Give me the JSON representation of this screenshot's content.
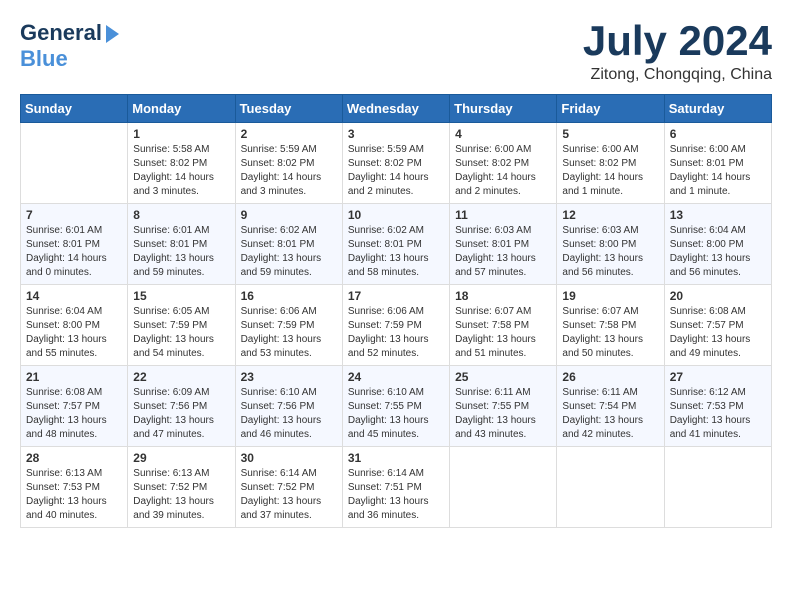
{
  "header": {
    "logo_general": "General",
    "logo_blue": "Blue",
    "month_title": "July 2024",
    "location": "Zitong, Chongqing, China"
  },
  "calendar": {
    "days_of_week": [
      "Sunday",
      "Monday",
      "Tuesday",
      "Wednesday",
      "Thursday",
      "Friday",
      "Saturday"
    ],
    "weeks": [
      [
        {
          "day": "",
          "info": ""
        },
        {
          "day": "1",
          "info": "Sunrise: 5:58 AM\nSunset: 8:02 PM\nDaylight: 14 hours\nand 3 minutes."
        },
        {
          "day": "2",
          "info": "Sunrise: 5:59 AM\nSunset: 8:02 PM\nDaylight: 14 hours\nand 3 minutes."
        },
        {
          "day": "3",
          "info": "Sunrise: 5:59 AM\nSunset: 8:02 PM\nDaylight: 14 hours\nand 2 minutes."
        },
        {
          "day": "4",
          "info": "Sunrise: 6:00 AM\nSunset: 8:02 PM\nDaylight: 14 hours\nand 2 minutes."
        },
        {
          "day": "5",
          "info": "Sunrise: 6:00 AM\nSunset: 8:02 PM\nDaylight: 14 hours\nand 1 minute."
        },
        {
          "day": "6",
          "info": "Sunrise: 6:00 AM\nSunset: 8:01 PM\nDaylight: 14 hours\nand 1 minute."
        }
      ],
      [
        {
          "day": "7",
          "info": "Sunrise: 6:01 AM\nSunset: 8:01 PM\nDaylight: 14 hours\nand 0 minutes."
        },
        {
          "day": "8",
          "info": "Sunrise: 6:01 AM\nSunset: 8:01 PM\nDaylight: 13 hours\nand 59 minutes."
        },
        {
          "day": "9",
          "info": "Sunrise: 6:02 AM\nSunset: 8:01 PM\nDaylight: 13 hours\nand 59 minutes."
        },
        {
          "day": "10",
          "info": "Sunrise: 6:02 AM\nSunset: 8:01 PM\nDaylight: 13 hours\nand 58 minutes."
        },
        {
          "day": "11",
          "info": "Sunrise: 6:03 AM\nSunset: 8:01 PM\nDaylight: 13 hours\nand 57 minutes."
        },
        {
          "day": "12",
          "info": "Sunrise: 6:03 AM\nSunset: 8:00 PM\nDaylight: 13 hours\nand 56 minutes."
        },
        {
          "day": "13",
          "info": "Sunrise: 6:04 AM\nSunset: 8:00 PM\nDaylight: 13 hours\nand 56 minutes."
        }
      ],
      [
        {
          "day": "14",
          "info": "Sunrise: 6:04 AM\nSunset: 8:00 PM\nDaylight: 13 hours\nand 55 minutes."
        },
        {
          "day": "15",
          "info": "Sunrise: 6:05 AM\nSunset: 7:59 PM\nDaylight: 13 hours\nand 54 minutes."
        },
        {
          "day": "16",
          "info": "Sunrise: 6:06 AM\nSunset: 7:59 PM\nDaylight: 13 hours\nand 53 minutes."
        },
        {
          "day": "17",
          "info": "Sunrise: 6:06 AM\nSunset: 7:59 PM\nDaylight: 13 hours\nand 52 minutes."
        },
        {
          "day": "18",
          "info": "Sunrise: 6:07 AM\nSunset: 7:58 PM\nDaylight: 13 hours\nand 51 minutes."
        },
        {
          "day": "19",
          "info": "Sunrise: 6:07 AM\nSunset: 7:58 PM\nDaylight: 13 hours\nand 50 minutes."
        },
        {
          "day": "20",
          "info": "Sunrise: 6:08 AM\nSunset: 7:57 PM\nDaylight: 13 hours\nand 49 minutes."
        }
      ],
      [
        {
          "day": "21",
          "info": "Sunrise: 6:08 AM\nSunset: 7:57 PM\nDaylight: 13 hours\nand 48 minutes."
        },
        {
          "day": "22",
          "info": "Sunrise: 6:09 AM\nSunset: 7:56 PM\nDaylight: 13 hours\nand 47 minutes."
        },
        {
          "day": "23",
          "info": "Sunrise: 6:10 AM\nSunset: 7:56 PM\nDaylight: 13 hours\nand 46 minutes."
        },
        {
          "day": "24",
          "info": "Sunrise: 6:10 AM\nSunset: 7:55 PM\nDaylight: 13 hours\nand 45 minutes."
        },
        {
          "day": "25",
          "info": "Sunrise: 6:11 AM\nSunset: 7:55 PM\nDaylight: 13 hours\nand 43 minutes."
        },
        {
          "day": "26",
          "info": "Sunrise: 6:11 AM\nSunset: 7:54 PM\nDaylight: 13 hours\nand 42 minutes."
        },
        {
          "day": "27",
          "info": "Sunrise: 6:12 AM\nSunset: 7:53 PM\nDaylight: 13 hours\nand 41 minutes."
        }
      ],
      [
        {
          "day": "28",
          "info": "Sunrise: 6:13 AM\nSunset: 7:53 PM\nDaylight: 13 hours\nand 40 minutes."
        },
        {
          "day": "29",
          "info": "Sunrise: 6:13 AM\nSunset: 7:52 PM\nDaylight: 13 hours\nand 39 minutes."
        },
        {
          "day": "30",
          "info": "Sunrise: 6:14 AM\nSunset: 7:52 PM\nDaylight: 13 hours\nand 37 minutes."
        },
        {
          "day": "31",
          "info": "Sunrise: 6:14 AM\nSunset: 7:51 PM\nDaylight: 13 hours\nand 36 minutes."
        },
        {
          "day": "",
          "info": ""
        },
        {
          "day": "",
          "info": ""
        },
        {
          "day": "",
          "info": ""
        }
      ]
    ]
  }
}
